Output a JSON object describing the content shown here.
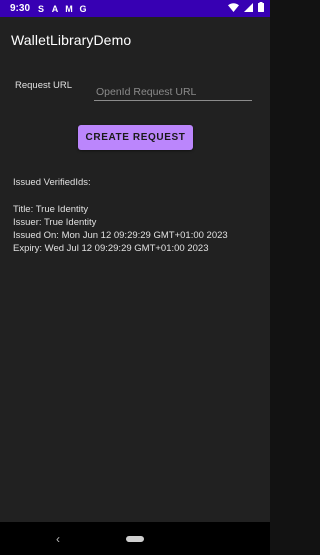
{
  "status_bar": {
    "time": "9:30",
    "left_icons": [
      "S",
      "A",
      "M",
      "G"
    ],
    "right_icons": [
      "wifi-icon",
      "signal-icon",
      "battery-icon"
    ]
  },
  "app_bar": {
    "title": "WalletLibraryDemo"
  },
  "request_form": {
    "url_label": "Request URL",
    "url_value": "",
    "url_placeholder": "OpenId Request URL",
    "create_button_label": "CREATE REQUEST"
  },
  "issued": {
    "header": "Issued VerifiedIds:",
    "title_line": "Title: True Identity",
    "issuer_line": "Issuer: True Identity",
    "issued_on_line": "Issued On: Mon Jun 12 09:29:29 GMT+01:00 2023",
    "expiry_line": "Expiry: Wed Jul 12 09:29:29 GMT+01:00 2023"
  },
  "nav_bar": {
    "back_glyph": "‹"
  },
  "colors": {
    "status_bar_bg": "#3700b3",
    "app_bar_bg": "#212121",
    "content_bg": "#212121",
    "button_bg": "#bb86fc",
    "nav_bar_bg": "#000000"
  }
}
